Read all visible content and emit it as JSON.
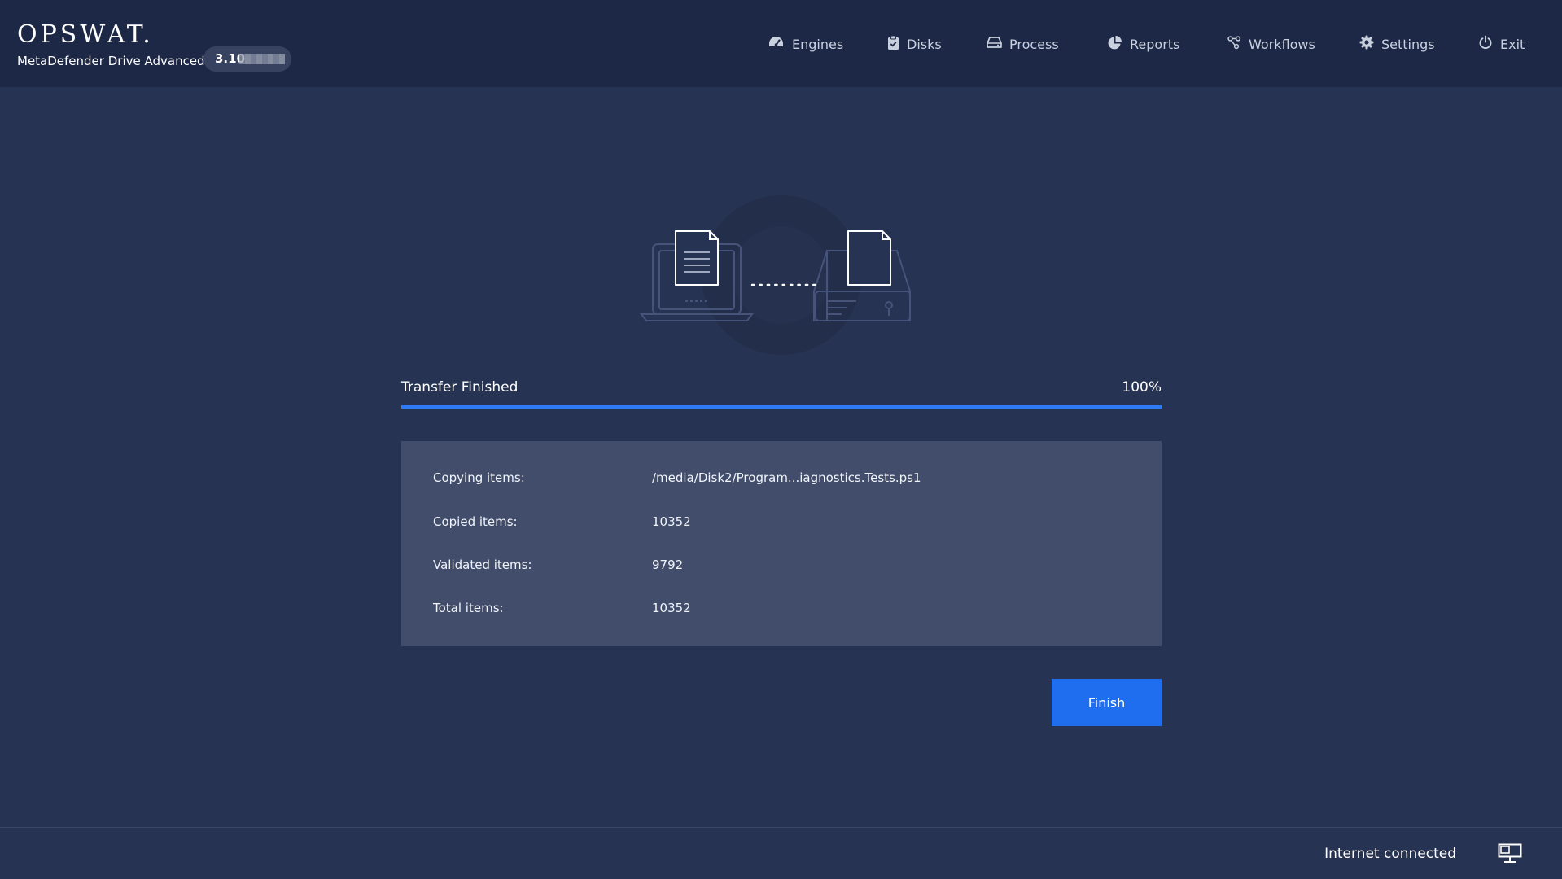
{
  "header": {
    "logo": "OPSWAT.",
    "product": "MetaDefender Drive Advanced",
    "version": "3.10"
  },
  "nav": [
    {
      "label": "Engines",
      "icon": "gauge-icon"
    },
    {
      "label": "Disks",
      "icon": "clipboard-check-icon"
    },
    {
      "label": "Process",
      "icon": "hard-drive-icon"
    },
    {
      "label": "Reports",
      "icon": "pie-chart-icon"
    },
    {
      "label": "Workflows",
      "icon": "workflow-icon"
    },
    {
      "label": "Settings",
      "icon": "gear-icon"
    },
    {
      "label": "Exit",
      "icon": "power-icon"
    }
  ],
  "transfer": {
    "status": "Transfer Finished",
    "percent_label": "100%",
    "progress": 1.0
  },
  "details": [
    {
      "key": "Copying items:",
      "value": "/media/Disk2/Program...iagnostics.Tests.ps1"
    },
    {
      "key": "Copied items:",
      "value": "10352"
    },
    {
      "key": "Validated items:",
      "value": "9792"
    },
    {
      "key": "Total items:",
      "value": "10352"
    }
  ],
  "actions": {
    "finish": "Finish"
  },
  "footer": {
    "connection": "Internet connected",
    "icon": "monitor-network-icon"
  },
  "colors": {
    "background": "#273352",
    "header": "#1c2846",
    "panel": "#414d6b",
    "accent": "#1f6ef0",
    "progress": "#2f7bf5"
  }
}
